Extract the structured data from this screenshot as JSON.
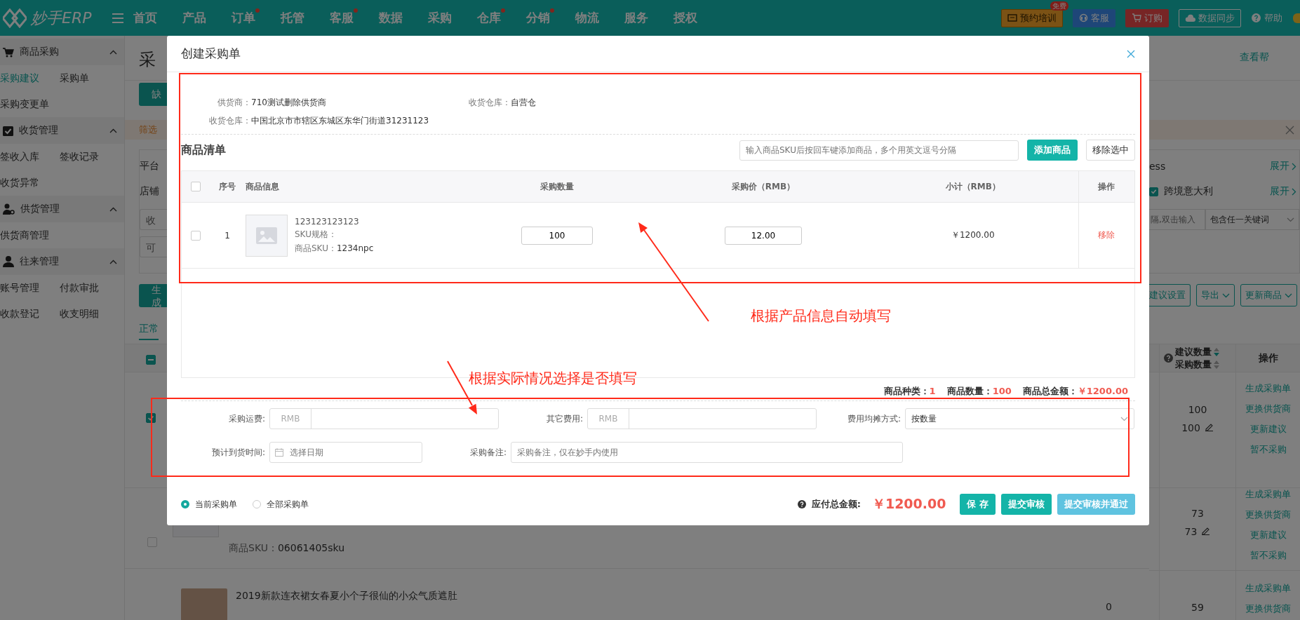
{
  "nav": {
    "logo": "妙手ERP",
    "menu": [
      {
        "label": "首页",
        "dot": false
      },
      {
        "label": "产品",
        "dot": false
      },
      {
        "label": "订单",
        "dot": true
      },
      {
        "label": "托管",
        "dot": false
      },
      {
        "label": "客服",
        "dot": true
      },
      {
        "label": "数据",
        "dot": false
      },
      {
        "label": "采购",
        "dot": false
      },
      {
        "label": "仓库",
        "dot": true
      },
      {
        "label": "分销",
        "dot": true
      },
      {
        "label": "物流",
        "dot": false
      },
      {
        "label": "服务",
        "dot": false
      },
      {
        "label": "授权",
        "dot": false
      }
    ],
    "actions": [
      {
        "kind": "training",
        "label": "预约培训",
        "badge": "免费"
      },
      {
        "kind": "service",
        "label": "客服"
      },
      {
        "kind": "order",
        "label": "订购"
      },
      {
        "kind": "sync",
        "label": "数据同步"
      },
      {
        "kind": "help",
        "label": "帮助"
      }
    ]
  },
  "sidebar": [
    {
      "title": "商品采购",
      "expanded": true,
      "items": [
        {
          "label": "采购建议",
          "selected": true
        },
        {
          "label": "采购单",
          "selected": false
        },
        {
          "label": "采购变更单",
          "selected": false
        }
      ]
    },
    {
      "title": "收货管理",
      "expanded": true,
      "items": [
        {
          "label": "签收入库",
          "selected": false
        },
        {
          "label": "签收记录",
          "selected": false
        },
        {
          "label": "收货异常",
          "selected": false
        }
      ]
    },
    {
      "title": "供货管理",
      "expanded": true,
      "items": [
        {
          "label": "供货商管理",
          "selected": false
        }
      ]
    },
    {
      "title": "往来管理",
      "expanded": true,
      "items": [
        {
          "label": "账号管理",
          "selected": false
        },
        {
          "label": "付款审批",
          "selected": false
        },
        {
          "label": "收款登记",
          "selected": false
        },
        {
          "label": "收支明细",
          "selected": false
        }
      ]
    }
  ],
  "page": {
    "title": "采",
    "help_link": "查看帮",
    "primary_button": "缺",
    "notice": "筛选",
    "filters": {
      "platform_label": "平台",
      "platform_value": "ess",
      "store_label": "店铺",
      "field_1": "收",
      "field_2": "可",
      "expand_links": [
        "展开",
        "展开"
      ],
      "site_option": {
        "label": "跨境意大利",
        "checked": true
      },
      "keyword_placeholder": "隔,双击输入",
      "match_select": "包含任一关键词"
    },
    "toolbar": {
      "generate_button": "生成",
      "buttons": [
        "建议设置",
        "导出",
        "更新商品"
      ]
    },
    "tabs": [
      {
        "label": "正常",
        "selected": true
      }
    ],
    "table": {
      "header_indeterminate": true,
      "quantity_headers": [
        "建议数量",
        "采购数量"
      ],
      "action_header": "操作",
      "rows": [
        {
          "checked": true,
          "suggested": "100",
          "purchase": "100",
          "actions": [
            "生成采购单",
            "更换供货商",
            "更新建议",
            "暂不采购"
          ]
        },
        {
          "checked": false,
          "sku_label": "商品SKU：",
          "sku": "06061405sku",
          "suggested": "73",
          "purchase": "73",
          "actions": [
            "生成采购单",
            "更换供货商",
            "更新建议",
            "暂不采购"
          ]
        },
        {
          "title": "2019新款连衣裙女春夏小个子很仙的小众气质遮肚",
          "stock": "0",
          "suggested": "59",
          "actions": [
            "生成采购单",
            "更换供货商"
          ]
        }
      ]
    }
  },
  "modal": {
    "title": "创建采购单",
    "info": [
      {
        "label": "供货商：",
        "value": "710测试删除供货商"
      },
      {
        "label": "收货仓库：",
        "value": "自营仓"
      },
      {
        "label": "收货仓库：",
        "value": "中国北京市市辖区东城区东华门街道31231123"
      }
    ],
    "list_title": "商品清单",
    "sku_input_placeholder": "输入商品SKU后按回车键添加商品，多个用英文逗号分隔",
    "add_button": "添加商品",
    "remove_selected_button": "移除选中",
    "select_all_checked": false,
    "columns": [
      "序号",
      "商品信息",
      "采购数量",
      "采购价（RMB）",
      "小计（RMB）",
      "操作"
    ],
    "items": [
      {
        "checked": false,
        "index": "1",
        "code": "123123123123",
        "spec_label": "SKU规格：",
        "sku_label": "商品SKU：",
        "sku": "1234npc",
        "quantity": "100",
        "price": "12.00",
        "subtotal": "￥1200.00",
        "action": "移除"
      }
    ],
    "summary": [
      {
        "label": "商品种类：",
        "value": "1"
      },
      {
        "label": "商品数量：",
        "value": "100"
      },
      {
        "label": "商品总金额：",
        "value": "￥1200.00"
      }
    ],
    "fields": [
      {
        "kind": "money",
        "label": "采购运费:",
        "prefix": "RMB"
      },
      {
        "kind": "money",
        "label": "其它费用:",
        "prefix": "RMB"
      },
      {
        "kind": "select",
        "label": "费用均摊方式:",
        "value": "按数量"
      },
      {
        "kind": "date",
        "label": "预计到货时间:",
        "placeholder": "选择日期"
      },
      {
        "kind": "text",
        "label": "采购备注:",
        "placeholder": "采购备注，仅在妙手内使用"
      }
    ],
    "scope": [
      {
        "label": "当前采购单",
        "selected": true
      },
      {
        "label": "全部采购单",
        "selected": false
      }
    ],
    "total_label": "应付总金额:",
    "total": "￥1200.00",
    "buttons": [
      {
        "label": "保 存",
        "kind": "primary"
      },
      {
        "label": "提交审核",
        "kind": "primary"
      },
      {
        "label": "提交审核并通过",
        "kind": "light"
      }
    ]
  },
  "annotations": [
    {
      "text": "根据产品信息自动填写"
    },
    {
      "text": "根据实际情况选择是否填写"
    }
  ]
}
